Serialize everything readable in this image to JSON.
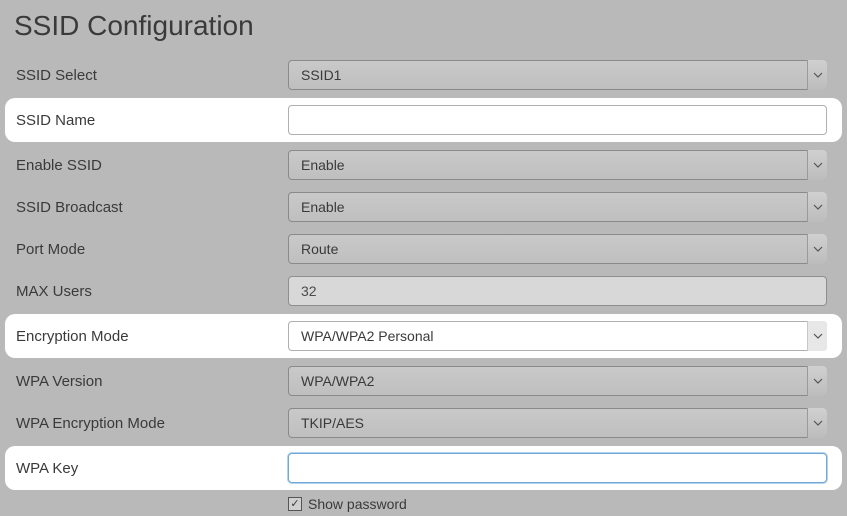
{
  "title": "SSID Configuration",
  "rows": {
    "ssid_select": {
      "label": "SSID Select",
      "value": "SSID1"
    },
    "ssid_name": {
      "label": "SSID Name",
      "value": ""
    },
    "enable_ssid": {
      "label": "Enable SSID",
      "value": "Enable"
    },
    "ssid_broadcast": {
      "label": "SSID Broadcast",
      "value": "Enable"
    },
    "port_mode": {
      "label": "Port Mode",
      "value": "Route"
    },
    "max_users": {
      "label": "MAX Users",
      "value": "32"
    },
    "encryption_mode": {
      "label": "Encryption Mode",
      "value": "WPA/WPA2 Personal"
    },
    "wpa_version": {
      "label": "WPA Version",
      "value": "WPA/WPA2"
    },
    "wpa_encrypt_mode": {
      "label": "WPA Encryption Mode",
      "value": "TKIP/AES"
    },
    "wpa_key": {
      "label": "WPA Key",
      "value": ""
    }
  },
  "show_password": {
    "label": "Show password",
    "checked": true
  }
}
